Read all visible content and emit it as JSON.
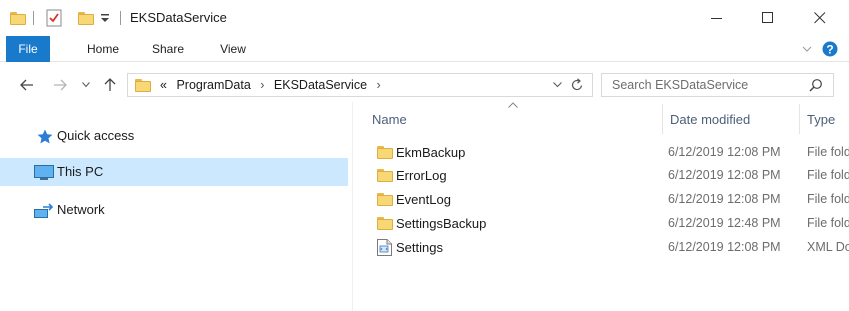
{
  "window": {
    "title": "EKSDataService",
    "minimize_icon": "minimize-icon",
    "maximize_icon": "maximize-icon",
    "close_icon": "close-icon"
  },
  "quick_access_toolbar": {
    "icons": [
      "folder-icon",
      "properties-check-icon",
      "new-folder-icon",
      "customize-dropdown-icon"
    ]
  },
  "ribbon": {
    "tabs": [
      {
        "label": "File"
      },
      {
        "label": "Home"
      },
      {
        "label": "Share"
      },
      {
        "label": "View"
      }
    ],
    "accent_color": "#1979ca"
  },
  "navigation": {
    "back_icon": "back-arrow-icon",
    "forward_icon": "forward-arrow-icon",
    "recent_icon": "chevron-down-icon",
    "up_icon": "up-arrow-icon"
  },
  "address_bar": {
    "overflow": "«",
    "segments": [
      "ProgramData",
      "EKSDataService"
    ],
    "separator": "›"
  },
  "search": {
    "placeholder": "Search EKSDataService"
  },
  "nav_pane": {
    "items": [
      {
        "label": "Quick access",
        "icon": "star-icon",
        "selected": false
      },
      {
        "label": "This PC",
        "icon": "computer-icon",
        "selected": true
      },
      {
        "label": "Network",
        "icon": "network-icon",
        "selected": false
      }
    ],
    "selection_color": "#cce8ff"
  },
  "file_list": {
    "columns": {
      "name": "Name",
      "date": "Date modified",
      "type": "Type"
    },
    "rows": [
      {
        "name": "EkmBackup",
        "date": "6/12/2019 12:08 PM",
        "type": "File folder",
        "icon": "folder-icon"
      },
      {
        "name": "ErrorLog",
        "date": "6/12/2019 12:08 PM",
        "type": "File folder",
        "icon": "folder-icon"
      },
      {
        "name": "EventLog",
        "date": "6/12/2019 12:08 PM",
        "type": "File folder",
        "icon": "folder-icon"
      },
      {
        "name": "SettingsBackup",
        "date": "6/12/2019 12:48 PM",
        "type": "File folder",
        "icon": "folder-icon"
      },
      {
        "name": "Settings",
        "date": "6/12/2019 12:08 PM",
        "type": "XML Document",
        "icon": "xml-file-icon"
      }
    ]
  }
}
